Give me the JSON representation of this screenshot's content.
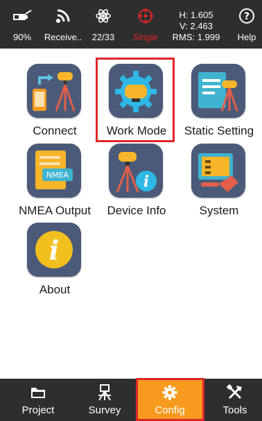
{
  "status_bar": {
    "battery_percent": "90%",
    "signal_label": "Receive..",
    "satellites_label": "22/33",
    "solution_label": "Single",
    "h_value": "H: 1.605",
    "v_value": "V: 2.463",
    "rms_value": "RMS: 1.999",
    "help_label": "Help"
  },
  "apps": [
    {
      "label": "Connect"
    },
    {
      "label": "Work Mode"
    },
    {
      "label": "Static Setting"
    },
    {
      "label": "NMEA Output"
    },
    {
      "label": "Device Info"
    },
    {
      "label": "System"
    },
    {
      "label": "About"
    }
  ],
  "nmea_badge": "NMEA",
  "nav": [
    {
      "label": "Project"
    },
    {
      "label": "Survey"
    },
    {
      "label": "Config"
    },
    {
      "label": "Tools"
    }
  ],
  "colors": {
    "bar_bg": "#2e2e2e",
    "accent": "#f79a1e",
    "highlight": "#e0242a",
    "tile_bg": "#4b5a78"
  }
}
